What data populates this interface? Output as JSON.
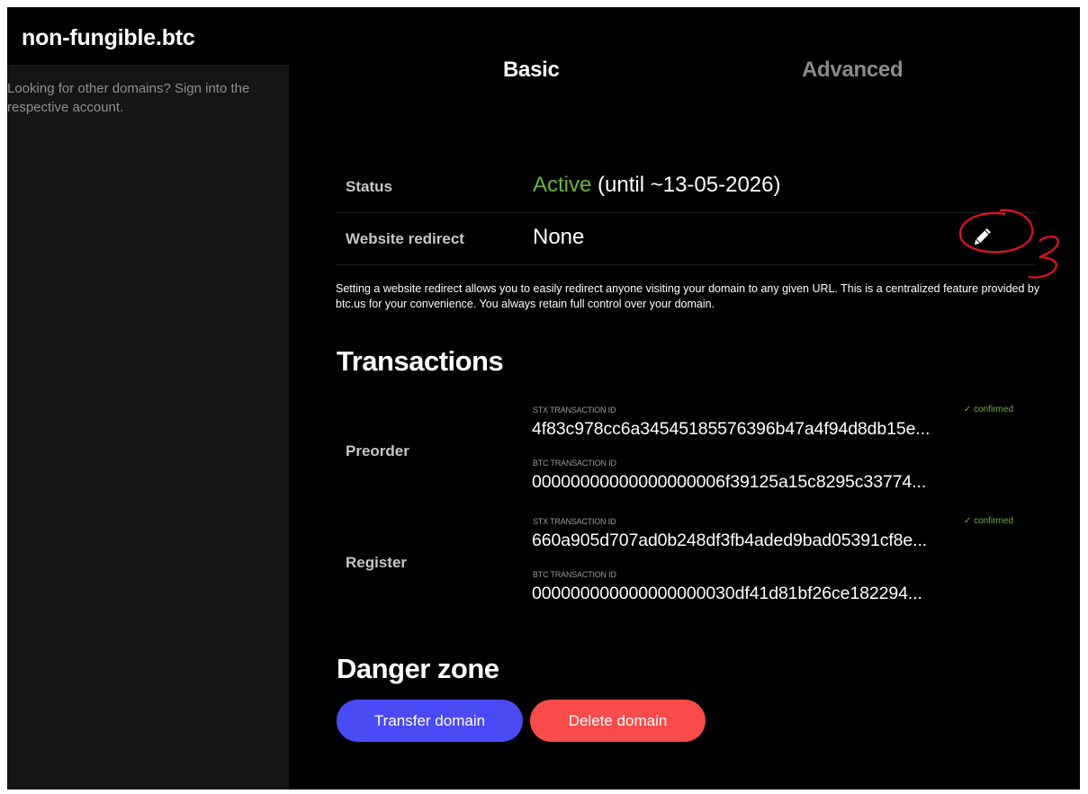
{
  "sidebar": {
    "domain": "non-fungible.btc",
    "hint": "Looking for other domains? Sign into the respective account."
  },
  "tabs": [
    {
      "label": "Basic",
      "active": true
    },
    {
      "label": "Advanced",
      "active": false
    }
  ],
  "status": {
    "label": "Status",
    "active_text": "Active",
    "until_text": " (until ~13-05-2026)"
  },
  "redirect": {
    "label": "Website redirect",
    "value": "None",
    "edit_icon": "pencil-icon",
    "note": "Setting a website redirect allows you to easily redirect anyone visiting your domain to any given URL. This is a centralized feature provided by btc.us for your convenience. You always retain full control over your domain."
  },
  "transactions": {
    "title": "Transactions",
    "preorder": {
      "label": "Preorder",
      "stx_caption": "STX TRANSACTION ID",
      "stx_id": "4f83c978cc6a34545185576396b47a4f94d8db15e...",
      "stx_status": "confirmed",
      "btc_caption": "BTC TRANSACTION ID",
      "btc_id": "00000000000000000006f39125a15c8295c33774..."
    },
    "register": {
      "label": "Register",
      "stx_caption": "STX TRANSACTION ID",
      "stx_id": "660a905d707ad0b248df3fb4aded9bad05391cf8e...",
      "stx_status": "confirmed",
      "btc_caption": "BTC TRANSACTION ID",
      "btc_id": "000000000000000000030df41d81bf26ce182294..."
    }
  },
  "danger": {
    "title": "Danger zone",
    "transfer_label": "Transfer domain",
    "delete_label": "Delete domain"
  },
  "colors": {
    "accent_green": "#69b340",
    "transfer_blue": "#4a4af5",
    "delete_red": "#f84b4b",
    "annotation_red": "#e0141e"
  }
}
